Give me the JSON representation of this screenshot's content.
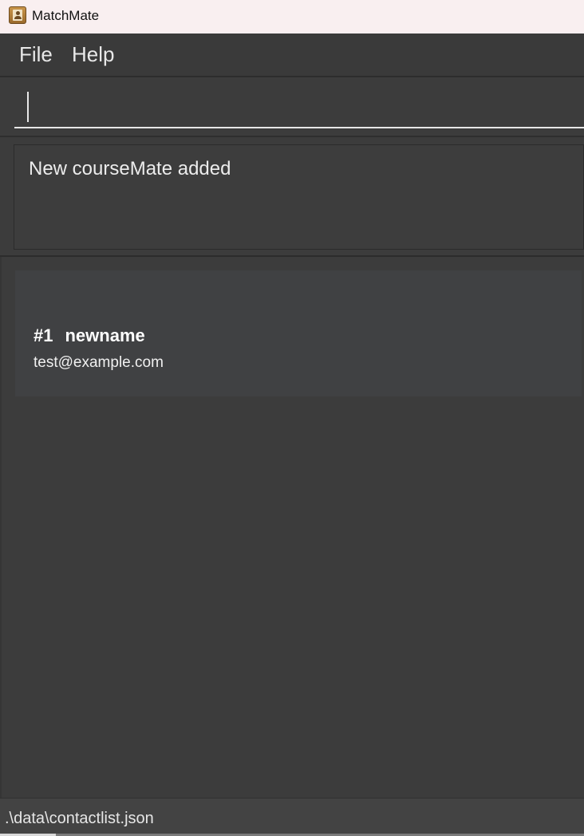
{
  "window": {
    "title": "MatchMate",
    "icon": "address-book-icon"
  },
  "menu": {
    "file_label": "File",
    "help_label": "Help"
  },
  "command": {
    "value": "",
    "placeholder": ""
  },
  "result": {
    "message": "New courseMate added"
  },
  "list": {
    "items": [
      {
        "index": "#1",
        "name": "newname",
        "email": "test@example.com"
      }
    ]
  },
  "status": {
    "file_path": ".\\data\\contactlist.json"
  },
  "colors": {
    "background": "#3c3c3c",
    "card_background": "#404143",
    "titlebar_background": "#f9eff0",
    "text": "#ffffff"
  }
}
